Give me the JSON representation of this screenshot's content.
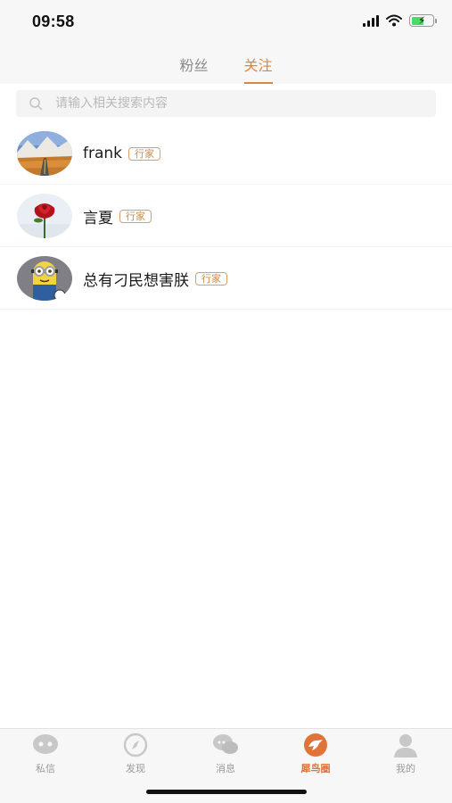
{
  "status_bar": {
    "time": "09:58"
  },
  "tabs": [
    {
      "label": "粉丝",
      "active": false
    },
    {
      "label": "关注",
      "active": true
    }
  ],
  "search": {
    "placeholder": "请输入相关搜索内容",
    "value": ""
  },
  "users": [
    {
      "name": "frank",
      "badge": "行家",
      "avatar": "mountain-road-avatar"
    },
    {
      "name": "言夏",
      "badge": "行家",
      "avatar": "red-rose-avatar"
    },
    {
      "name": "总有刁民想害朕",
      "badge": "行家",
      "avatar": "minion-avatar"
    }
  ],
  "tabbar": [
    {
      "label": "私信",
      "icon": "chat-bubble-icon",
      "active": false
    },
    {
      "label": "发现",
      "icon": "compass-icon",
      "active": false
    },
    {
      "label": "消息",
      "icon": "message-icon",
      "active": false
    },
    {
      "label": "犀鸟圈",
      "icon": "hornbill-circle-icon",
      "active": true
    },
    {
      "label": "我的",
      "icon": "person-icon",
      "active": false
    }
  ],
  "colors": {
    "accent": "#d9883a",
    "active_tab_label": "#e0733a",
    "inactive": "#9a9a9a"
  }
}
